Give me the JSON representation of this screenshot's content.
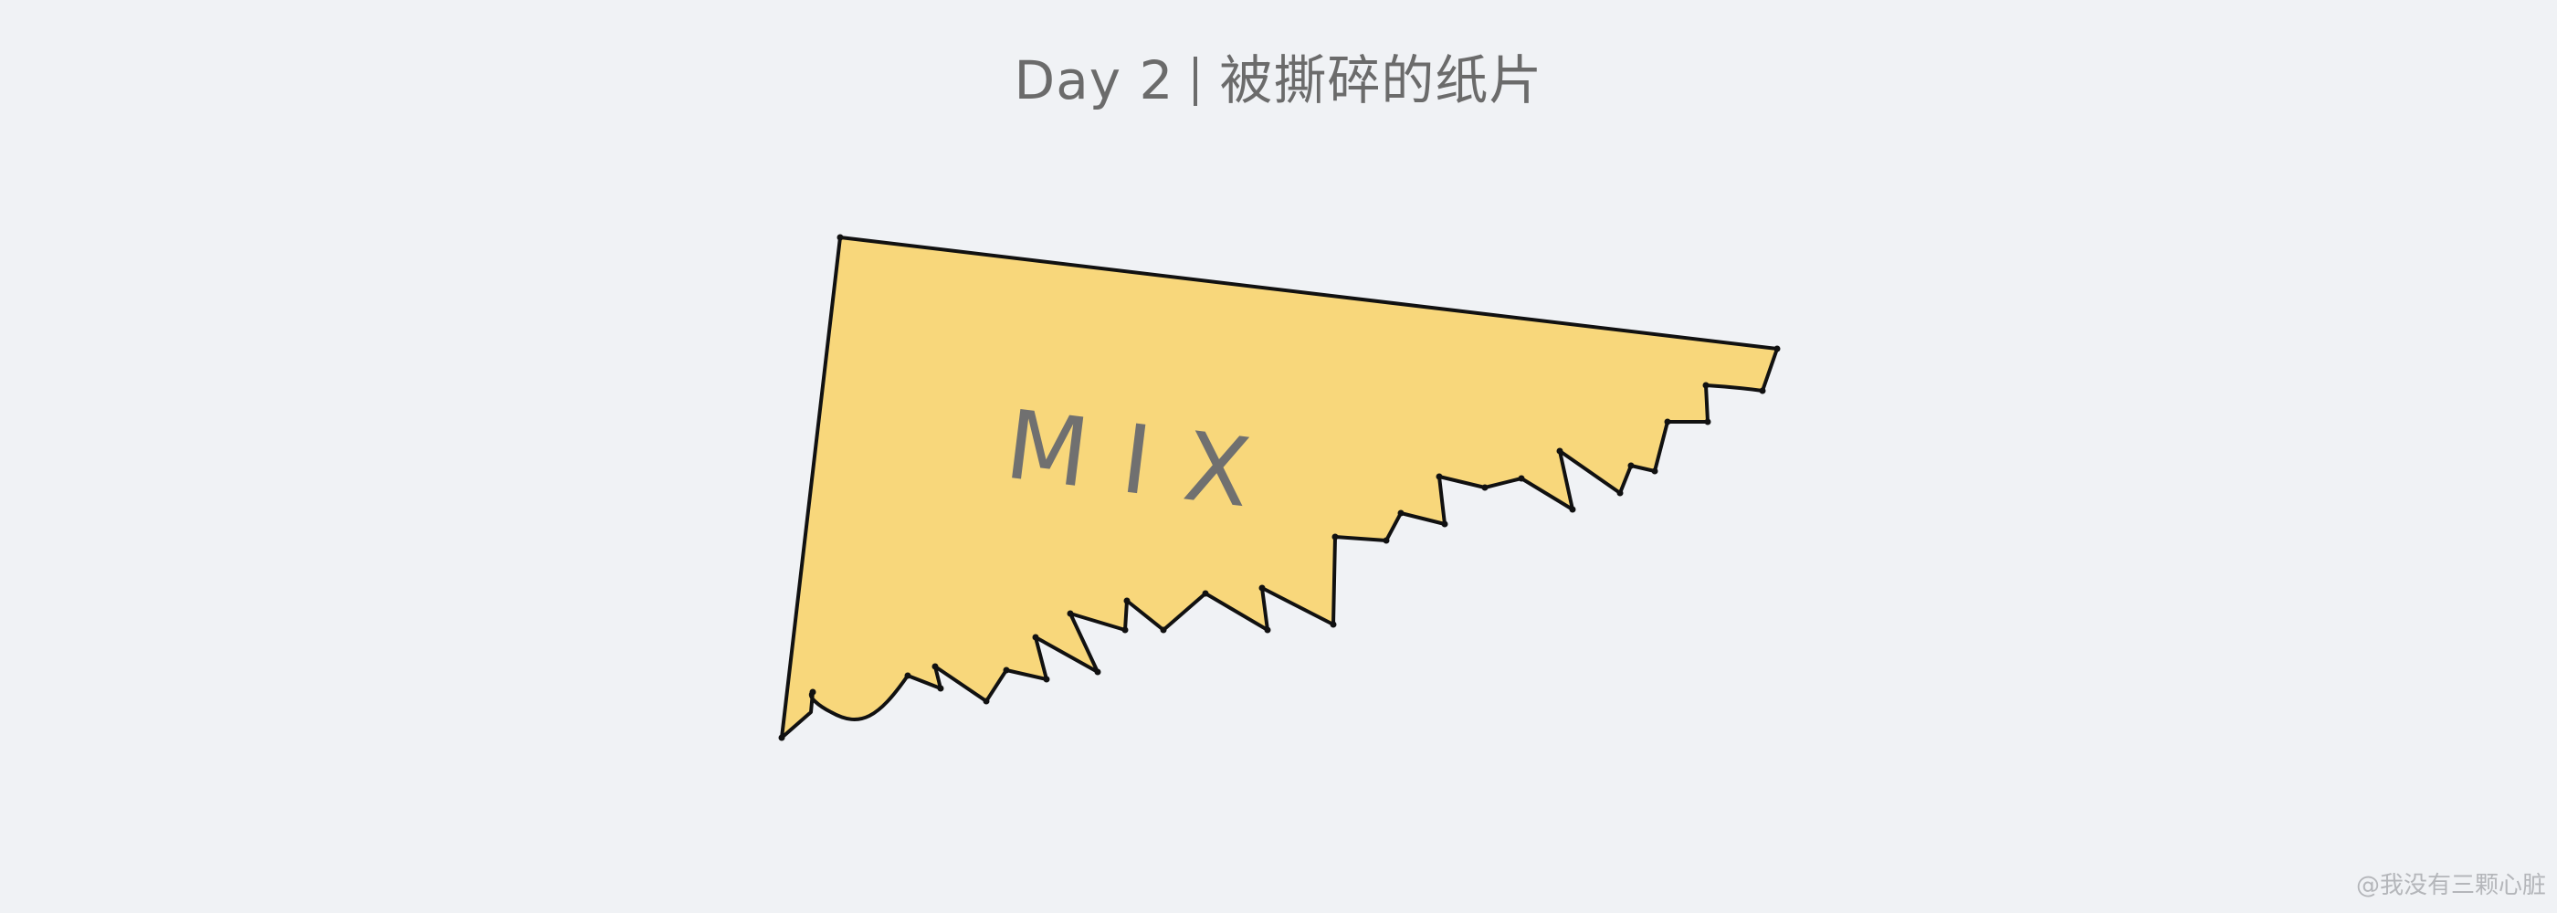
{
  "title": {
    "prefix": "Day 2",
    "text": "被撕碎的纸片"
  },
  "paper": {
    "label": "MIX",
    "fill_color": "#f8d77b",
    "stroke_color": "#111111"
  },
  "watermark": "@我没有三颗心脏",
  "colors": {
    "background": "#f0f2f5",
    "title_text": "#6b6b6b"
  }
}
